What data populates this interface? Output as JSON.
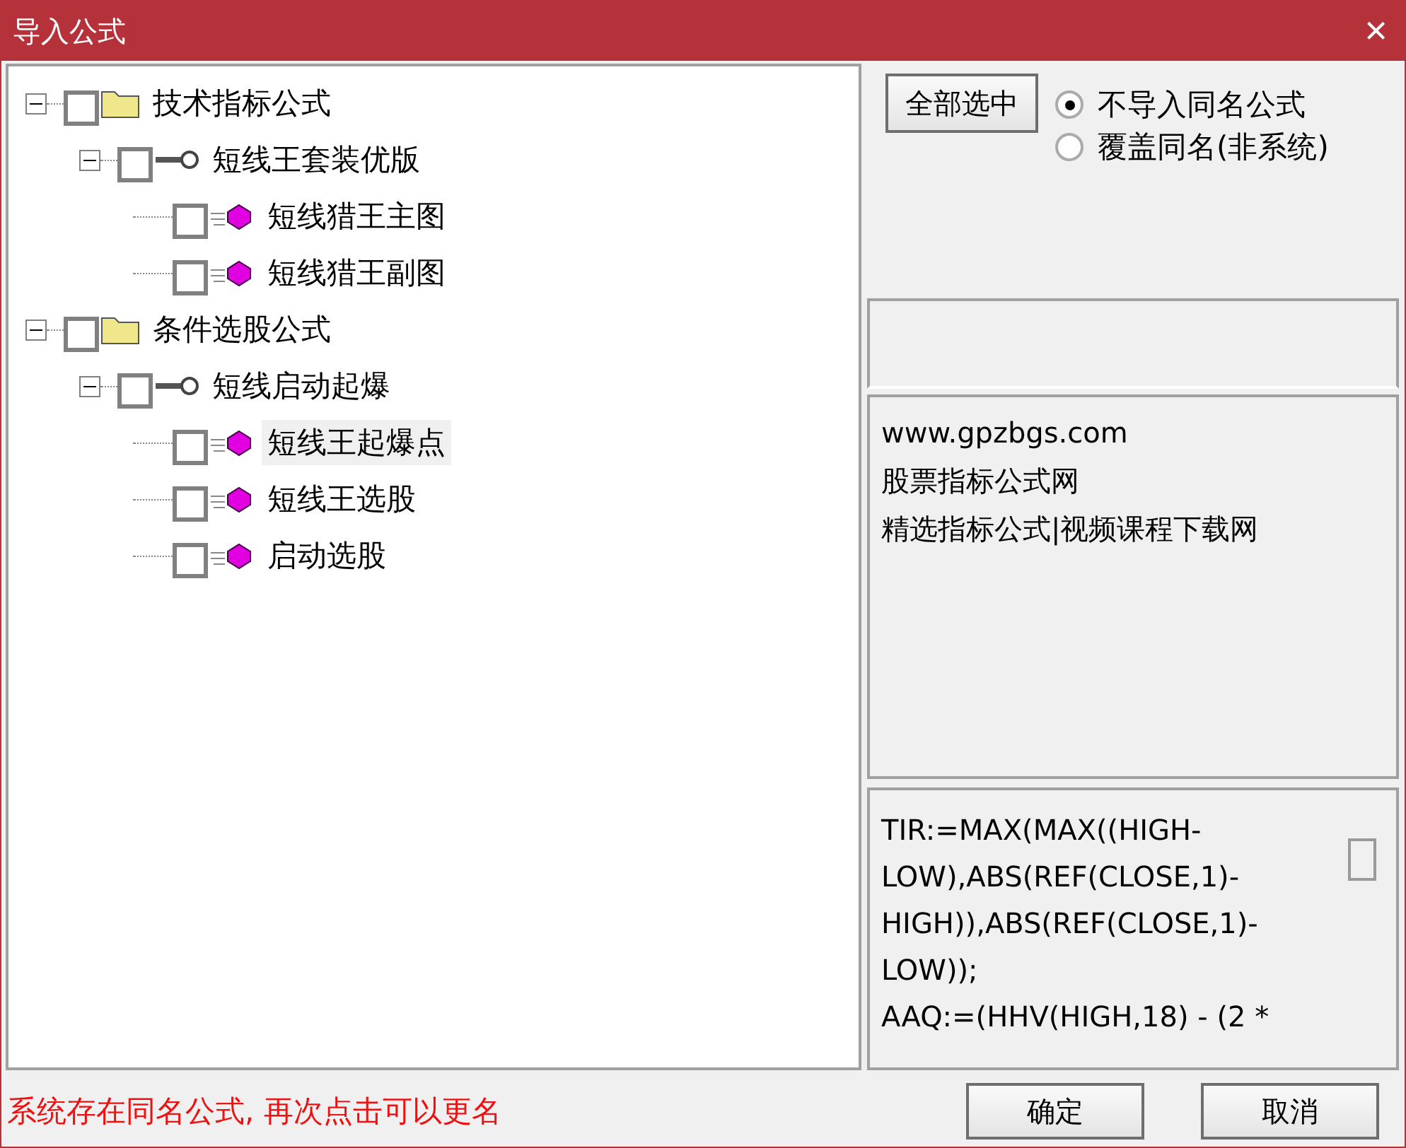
{
  "window": {
    "title": "导入公式",
    "close": "×"
  },
  "tree": [
    {
      "kind": "folder",
      "label": "技术指标公式",
      "checked": false,
      "expanded": true,
      "selected": false,
      "children": [
        {
          "kind": "group",
          "label": "短线王套装优版",
          "checked": false,
          "expanded": true,
          "selected": false,
          "children": [
            {
              "kind": "formula",
              "label": "短线猎王主图",
              "checked": false,
              "selected": false
            },
            {
              "kind": "formula",
              "label": "短线猎王副图",
              "checked": false,
              "selected": false
            }
          ]
        }
      ]
    },
    {
      "kind": "folder",
      "label": "条件选股公式",
      "checked": false,
      "expanded": true,
      "selected": false,
      "children": [
        {
          "kind": "group",
          "label": "短线启动起爆",
          "checked": false,
          "expanded": true,
          "selected": false,
          "children": [
            {
              "kind": "formula",
              "label": "短线王起爆点",
              "checked": false,
              "selected": true
            },
            {
              "kind": "formula",
              "label": "短线王选股",
              "checked": false,
              "selected": false
            },
            {
              "kind": "formula",
              "label": "启动选股",
              "checked": false,
              "selected": false
            }
          ]
        }
      ]
    }
  ],
  "select_all_button": "全部选中",
  "options": [
    {
      "label": "不导入同名公式",
      "selected": true
    },
    {
      "label": "覆盖同名(非系统)",
      "selected": false
    }
  ],
  "description": {
    "lines": [
      "www.gpzbgs.com",
      "股票指标公式网",
      "精选指标公式|视频课程下载网"
    ]
  },
  "formula": {
    "lines": [
      "TIR:=MAX(MAX((HIGH-",
      "LOW),ABS(REF(CLOSE,1)-",
      "HIGH)),ABS(REF(CLOSE,1)-",
      "LOW));",
      "AAQ:=(HHV(HIGH,18) - (2 *"
    ]
  },
  "status": "系统存在同名公式, 再次点击可以更名",
  "buttons": [
    "确定",
    "取消"
  ]
}
